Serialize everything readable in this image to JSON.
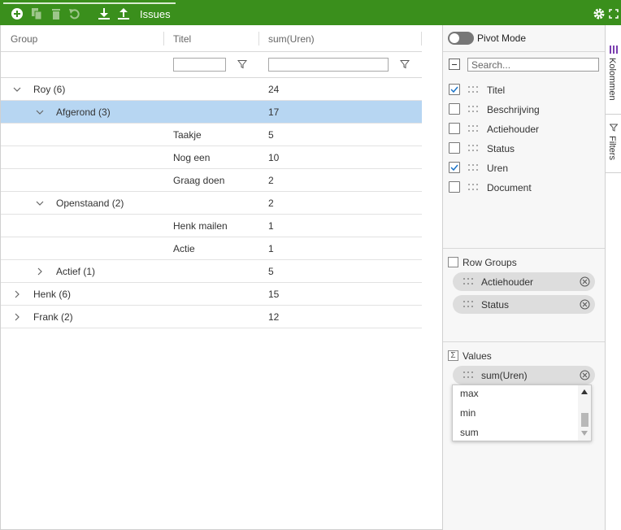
{
  "toolbar": {
    "title": "Issues",
    "buttons": [
      "add-icon",
      "copy-icon",
      "delete-icon",
      "undo-icon",
      "download-icon",
      "upload-icon"
    ],
    "settings_icon": "gear-icon",
    "fullscreen_icon": "fullscreen-icon",
    "accent": "#3a8f1c"
  },
  "grid": {
    "headers": {
      "group": "Group",
      "titel": "Titel",
      "sum": "sum(Uren)"
    },
    "filters": {
      "titel_value": "",
      "sum_value": ""
    },
    "rows": [
      {
        "group": "Roy (6)",
        "titel": "",
        "value": "24"
      },
      {
        "group": "Afgerond (3)",
        "titel": "",
        "value": "17"
      },
      {
        "group": "",
        "titel": "Taakje",
        "value": "5"
      },
      {
        "group": "",
        "titel": "Nog een",
        "value": "10"
      },
      {
        "group": "",
        "titel": "Graag doen",
        "value": "2"
      },
      {
        "group": "Openstaand (2)",
        "titel": "",
        "value": "2"
      },
      {
        "group": "",
        "titel": "Henk mailen",
        "value": "1"
      },
      {
        "group": "",
        "titel": "Actie",
        "value": "1"
      },
      {
        "group": "Actief (1)",
        "titel": "",
        "value": "5"
      },
      {
        "group": "Henk (6)",
        "titel": "",
        "value": "15"
      },
      {
        "group": "Frank (2)",
        "titel": "",
        "value": "12"
      }
    ],
    "selected_row": "Afgerond (3)",
    "selection_color": "#b7d6f2"
  },
  "sidebar": {
    "pivot_mode": {
      "label": "Pivot Mode",
      "enabled": false
    },
    "search_placeholder": "Search...",
    "columns": [
      {
        "label": "Titel",
        "checked": true
      },
      {
        "label": "Beschrijving",
        "checked": false
      },
      {
        "label": "Actiehouder",
        "checked": false
      },
      {
        "label": "Status",
        "checked": false
      },
      {
        "label": "Uren",
        "checked": true
      },
      {
        "label": "Document",
        "checked": false
      }
    ],
    "row_groups": {
      "title": "Row Groups",
      "items": [
        "Actiehouder",
        "Status"
      ]
    },
    "values": {
      "title": "Values",
      "items": [
        "sum(Uren)"
      ]
    },
    "agg_dropdown": {
      "options": [
        "max",
        "min",
        "sum"
      ]
    }
  },
  "vertical_tabs": {
    "columns": "Kolommen",
    "filters": "Filters"
  }
}
